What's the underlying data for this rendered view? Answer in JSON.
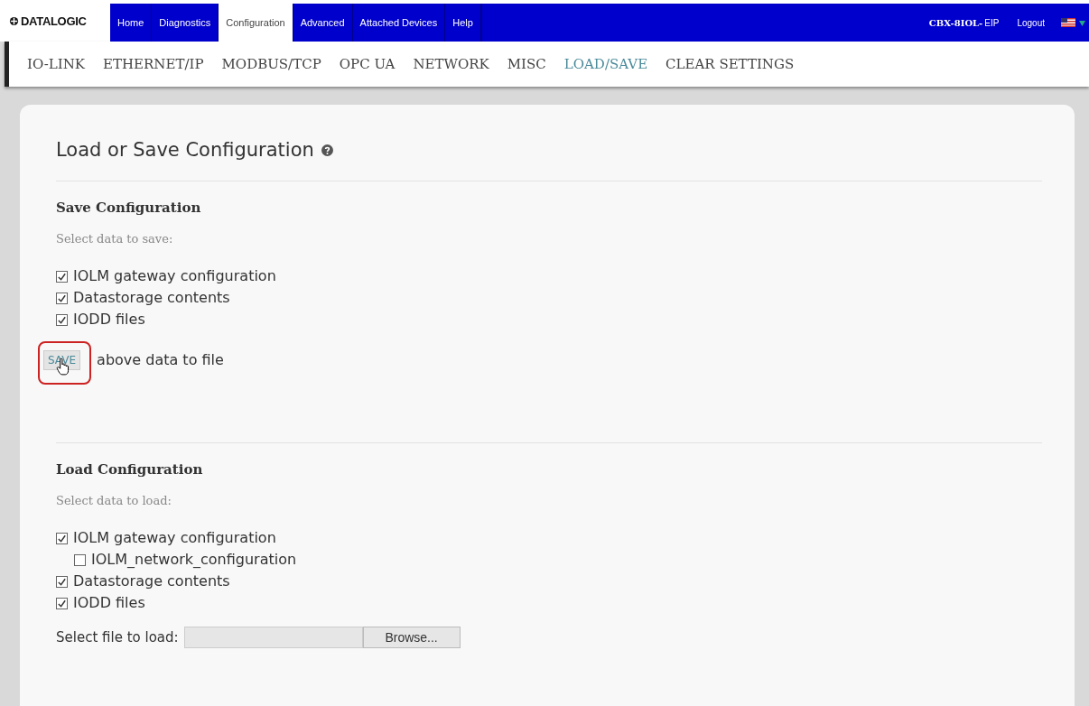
{
  "header": {
    "logo": "DATALOGIC",
    "nav": [
      {
        "label": "Home",
        "selected": false
      },
      {
        "label": "Diagnostics",
        "selected": false
      },
      {
        "label": "Configuration",
        "selected": true
      },
      {
        "label": "Advanced",
        "selected": false
      },
      {
        "label": "Attached Devices",
        "selected": false
      },
      {
        "label": "Help",
        "selected": false
      }
    ],
    "device_model": "CBX-8IOL-",
    "device_suffix": "EIP",
    "logout": "Logout"
  },
  "subnav": [
    {
      "label": "IO-LINK",
      "selected": false
    },
    {
      "label": "ETHERNET/IP",
      "selected": false
    },
    {
      "label": "MODBUS/TCP",
      "selected": false
    },
    {
      "label": "OPC UA",
      "selected": false
    },
    {
      "label": "NETWORK",
      "selected": false
    },
    {
      "label": "MISC",
      "selected": false
    },
    {
      "label": "LOAD/SAVE",
      "selected": true
    },
    {
      "label": "CLEAR SETTINGS",
      "selected": false
    }
  ],
  "page_title": "Load or Save Configuration",
  "save_section": {
    "title": "Save Configuration",
    "hint": "Select data to save:",
    "options": [
      {
        "label": "IOLM gateway configuration",
        "checked": true
      },
      {
        "label": "Datastorage contents",
        "checked": true
      },
      {
        "label": "IODD files",
        "checked": true
      }
    ],
    "button": "SAVE",
    "button_caption": "above data to file"
  },
  "load_section": {
    "title": "Load Configuration",
    "hint": "Select data to load:",
    "options": [
      {
        "label": "IOLM gateway configuration",
        "checked": true,
        "children": [
          {
            "label": "IOLM_network_configuration",
            "checked": false
          }
        ]
      },
      {
        "label": "Datastorage contents",
        "checked": true
      },
      {
        "label": "IODD files",
        "checked": true
      }
    ],
    "file_label": "Select file to load:",
    "browse": "Browse..."
  }
}
